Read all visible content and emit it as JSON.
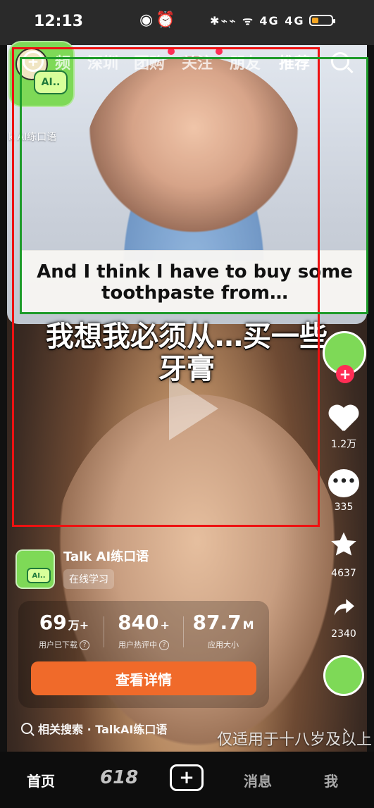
{
  "status_bar": {
    "time": "12:13",
    "center_icons": "◉⏰",
    "right_icons": "✱⌁⌁ ᯤ 4G 4G"
  },
  "top_nav": {
    "tabs": [
      "频",
      "深圳",
      "团购",
      "关注",
      "朋友",
      "推荐"
    ],
    "active_tab": "推荐"
  },
  "top_overlay": {
    "app_name_small": "k AI练口语",
    "logo_badge": "AI.."
  },
  "captions": {
    "english": "And I think I have to buy some toothpaste from…",
    "chinese": "我想我必须从…买一些牙膏"
  },
  "side_actions": {
    "likes": "1.2万",
    "comments": "335",
    "favorites": "4637",
    "shares": "2340"
  },
  "ad": {
    "name": "Talk AI练口语",
    "tag": "在线学习",
    "stats": [
      {
        "num": "69",
        "unit": "万+",
        "label": "用户已下载"
      },
      {
        "num": "840",
        "unit": "+",
        "label": "用户热评中"
      },
      {
        "num": "87.7",
        "unit": "M",
        "label": "应用大小"
      }
    ],
    "cta": "查看详情"
  },
  "related_search": {
    "text": "相关搜索 · TalkAI练口语"
  },
  "age_notice": "仅适用于十八岁及以上",
  "bottom_tabs": {
    "home": "首页",
    "promo": "618",
    "messages": "消息",
    "me": "我"
  }
}
